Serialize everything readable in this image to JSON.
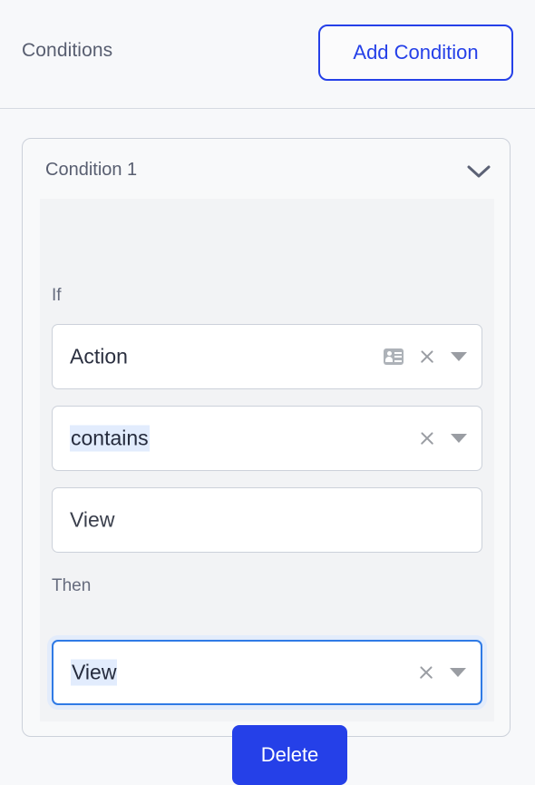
{
  "header": {
    "title": "Conditions",
    "add_button_label": "Add Condition"
  },
  "condition_card": {
    "title": "Condition 1",
    "collapse_icon": "chevron-down-icon",
    "if_label": "If",
    "then_label": "Then",
    "if_fields": [
      {
        "value": "Action",
        "highlighted": false,
        "icons": [
          "contact-card-icon",
          "clear-icon",
          "dropdown-caret-icon"
        ]
      },
      {
        "value": "contains",
        "highlighted": true,
        "icons": [
          "clear-icon",
          "dropdown-caret-icon"
        ]
      },
      {
        "value": "View",
        "highlighted": false,
        "icons": []
      }
    ],
    "then_field": {
      "value": "View",
      "highlighted": true,
      "focused": true,
      "icons": [
        "clear-icon",
        "dropdown-caret-icon"
      ]
    },
    "delete_button_label": "Delete"
  },
  "colors": {
    "accent": "#2540e8",
    "focus_border": "#2f7ae5",
    "focus_ring": "#e3ecfb",
    "selection_highlight": "#e2ecfd",
    "page_background": "#f7f8fa",
    "card_background": "#f8f9fa",
    "inner_panel_background": "#f2f3f5",
    "border": "#ccd1da",
    "label_text": "#666c7e",
    "title_text": "#585e70",
    "icon_gray": "#9a9da3"
  }
}
